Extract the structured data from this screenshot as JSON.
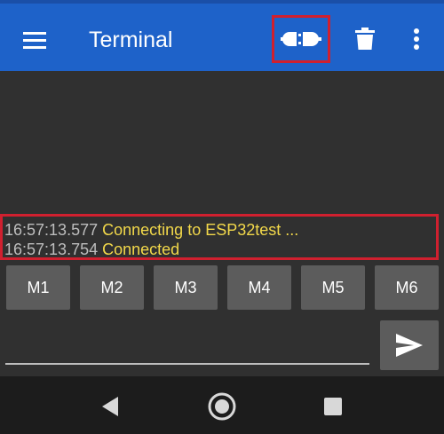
{
  "appbar": {
    "title": "Terminal",
    "menu_icon": "menu-icon",
    "connect_icon": "plug-connect-icon",
    "delete_icon": "trash-icon",
    "more_icon": "more-vertical-icon",
    "color": "#1e62c9"
  },
  "log": {
    "lines": [
      {
        "time": "16:57:13.577",
        "message": "Connecting to ESP32test ..."
      },
      {
        "time": "16:57:13.754",
        "message": "Connected"
      }
    ],
    "timestamp_color": "#bdbdbd",
    "message_color": "#f2d84a"
  },
  "macros": [
    "M1",
    "M2",
    "M3",
    "M4",
    "M5",
    "M6"
  ],
  "input": {
    "value": "",
    "placeholder": "",
    "send_icon": "send-icon"
  },
  "navbar": {
    "back_icon": "back-icon",
    "home_icon": "home-icon",
    "recents_icon": "recents-icon"
  },
  "highlight_color": "#d0202f"
}
